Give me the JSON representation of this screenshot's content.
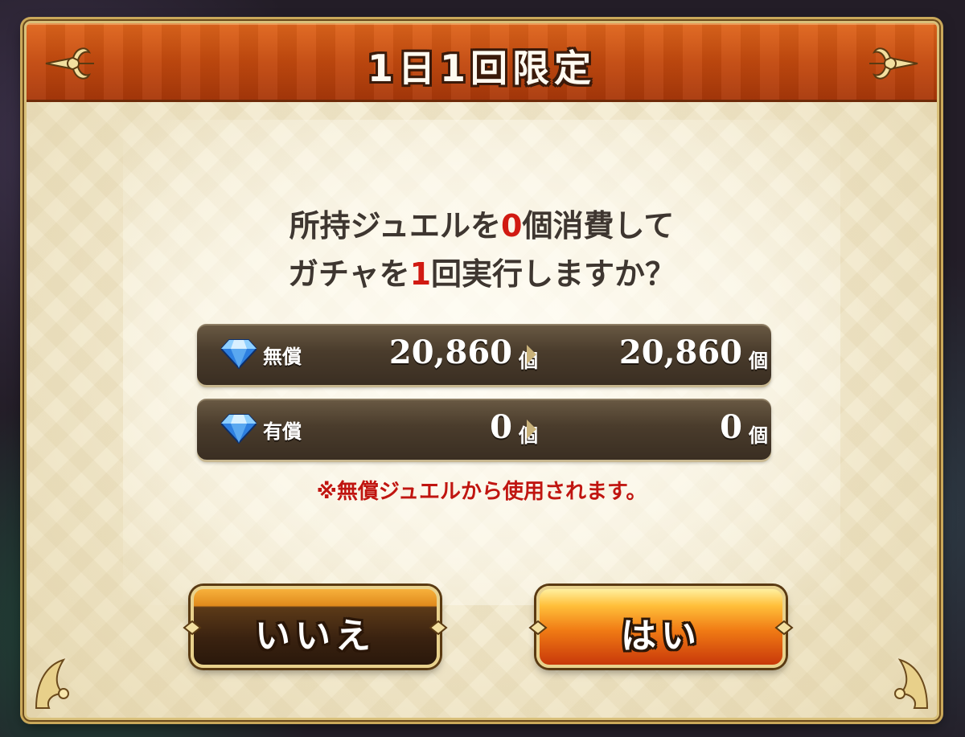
{
  "dialog": {
    "title": "1日1回限定",
    "message": {
      "line1_prefix": "所持ジュエルを",
      "line1_number": "0",
      "line1_suffix": "個消費して",
      "line2_prefix": "ガチャを",
      "line2_number": "1",
      "line2_suffix": "回実行しますか？"
    },
    "rows": [
      {
        "label": "無償",
        "before": "20,860",
        "after": "20,860",
        "unit": "個",
        "icon": "jewel-icon"
      },
      {
        "label": "有償",
        "before": "0",
        "after": "0",
        "unit": "個",
        "icon": "jewel-icon"
      }
    ],
    "note": "※無償ジュエルから使用されます。",
    "buttons": {
      "no_label": "いいえ",
      "yes_label": "はい"
    }
  },
  "colors": {
    "header": "#c44a0f",
    "accent_red": "#d11a12",
    "row_bg": "#4a3c2c",
    "panel_bg": "#f4ecd3",
    "gold_border": "#d9c07a"
  }
}
